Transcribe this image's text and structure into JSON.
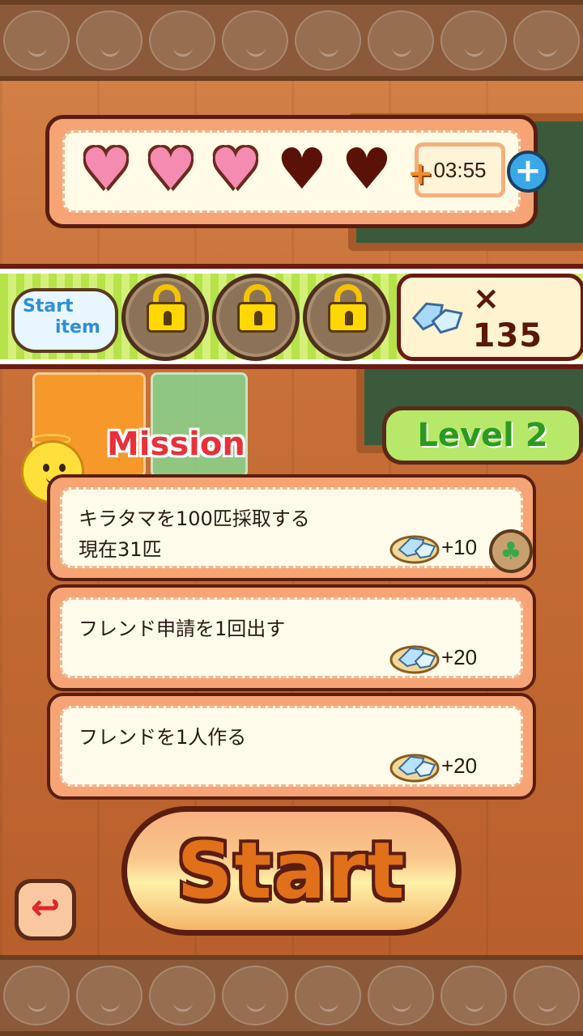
{
  "hearts": {
    "filled": 3,
    "total": 5,
    "timer": "03:55"
  },
  "start_item": {
    "label_line1": "Start",
    "label_line2": "item",
    "locked_slots": 3
  },
  "gems": {
    "count_text": "× 135"
  },
  "level": {
    "label": "Level 2"
  },
  "mission": {
    "label": "Mission",
    "items": [
      {
        "title": "キラタマを100匹採取する",
        "progress": "現在31匹",
        "reward": "+10"
      },
      {
        "title": "フレンド申請を1回出す",
        "progress": "",
        "reward": "+20"
      },
      {
        "title": "フレンドを1人作る",
        "progress": "",
        "reward": "+20"
      }
    ]
  },
  "start_button": {
    "label": "Start"
  },
  "colors": {
    "accent": "#e0701a",
    "mission_red": "#e8303a",
    "level_green": "#2c9a22"
  }
}
